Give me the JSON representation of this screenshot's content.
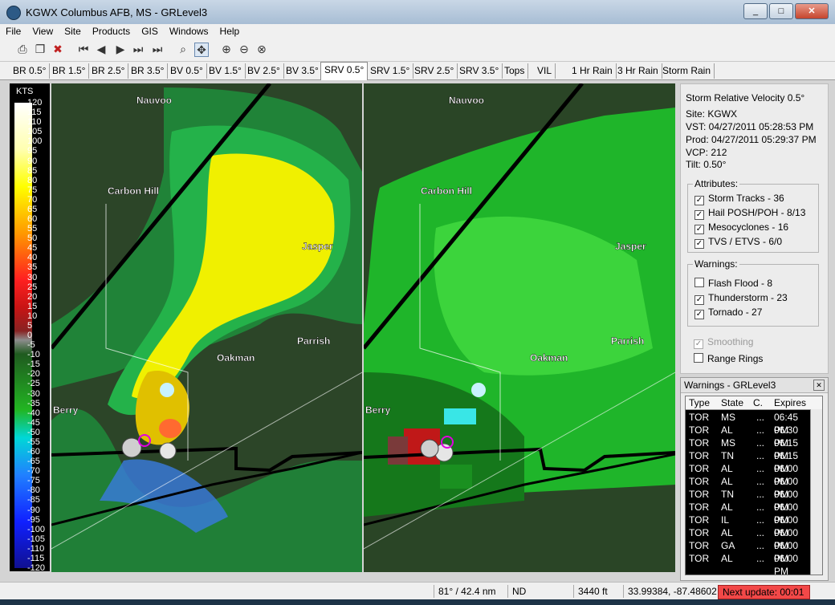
{
  "window": {
    "title": "KGWX Columbus AFB, MS - GRLevel3"
  },
  "menu": [
    "File",
    "View",
    "Site",
    "Products",
    "GIS",
    "Windows",
    "Help"
  ],
  "tabs": [
    "BR 0.5°",
    "BR 1.5°",
    "BR 2.5°",
    "BR 3.5°",
    "BV 0.5°",
    "BV 1.5°",
    "BV 2.5°",
    "BV 3.5°",
    "SRV 0.5°",
    "SRV 1.5°",
    "SRV 2.5°",
    "SRV 3.5°",
    "Tops",
    "VIL",
    "1 Hr Rain",
    "3 Hr Rain",
    "Storm Rain"
  ],
  "active_tab": "SRV 0.5°",
  "scale": {
    "unit": "KTS",
    "ticks": [
      "120",
      "115",
      "110",
      "105",
      "100",
      "95",
      "90",
      "85",
      "80",
      "75",
      "70",
      "65",
      "60",
      "55",
      "50",
      "45",
      "40",
      "35",
      "30",
      "25",
      "20",
      "15",
      "10",
      "5",
      "0",
      "-5",
      "-10",
      "-15",
      "-20",
      "-25",
      "-30",
      "-35",
      "-40",
      "-45",
      "-50",
      "-55",
      "-60",
      "-65",
      "-70",
      "-75",
      "-80",
      "-85",
      "-90",
      "-95",
      "-100",
      "-105",
      "-110",
      "-115",
      "-120"
    ]
  },
  "cities": [
    "Nauvoo",
    "Carbon Hill",
    "Jasper",
    "Parrish",
    "Oakman",
    "Berry"
  ],
  "info": {
    "product": "Storm Relative Velocity 0.5°",
    "site": "Site:  KGWX",
    "vst": "VST:  04/27/2011  05:28:53 PM",
    "prod": "Prod: 04/27/2011  05:29:37 PM",
    "vcp": "VCP:  212",
    "tilt": "Tilt:  0.50°"
  },
  "attributes": {
    "label": "Attributes:",
    "items": [
      {
        "label": "Storm Tracks - 36",
        "checked": true
      },
      {
        "label": "Hail POSH/POH - 8/13",
        "checked": true
      },
      {
        "label": "Mesocyclones - 16",
        "checked": true
      },
      {
        "label": "TVS / ETVS - 6/0",
        "checked": true
      }
    ]
  },
  "warnings_group": {
    "label": "Warnings:",
    "items": [
      {
        "label": "Flash Flood - 8",
        "checked": false
      },
      {
        "label": "Thunderstorm - 23",
        "checked": true
      },
      {
        "label": "Tornado - 27",
        "checked": true
      }
    ]
  },
  "options": {
    "smoothing": {
      "label": "Smoothing",
      "checked": true
    },
    "range_rings": {
      "label": "Range Rings",
      "checked": false
    }
  },
  "warnings_panel": {
    "title": "Warnings - GRLevel3",
    "columns": [
      "Type",
      "State",
      "C.",
      "Expires"
    ],
    "rows": [
      [
        "TOR",
        "MS",
        "...",
        "06:45 PM"
      ],
      [
        "TOR",
        "AL",
        "...",
        "06:30 PM"
      ],
      [
        "TOR",
        "MS",
        "...",
        "06:15 PM"
      ],
      [
        "TOR",
        "TN",
        "...",
        "06:15 PM"
      ],
      [
        "TOR",
        "AL",
        "...",
        "06:00 PM"
      ],
      [
        "TOR",
        "AL",
        "...",
        "06:00 PM"
      ],
      [
        "TOR",
        "TN",
        "...",
        "06:00 PM"
      ],
      [
        "TOR",
        "AL",
        "...",
        "06:00 PM"
      ],
      [
        "TOR",
        "IL",
        "...",
        "06:00 PM"
      ],
      [
        "TOR",
        "AL",
        "...",
        "06:00 PM"
      ],
      [
        "TOR",
        "GA",
        "...",
        "06:00 PM"
      ],
      [
        "TOR",
        "AL",
        "...",
        "06:00 PM"
      ]
    ]
  },
  "status": {
    "azimuth": "81° / 42.4 nm",
    "value": "ND",
    "height": "3440 ft",
    "coords": "33.99384, -87.48602",
    "next_update": "Next update: 00:01"
  },
  "colors": {
    "positive_max": "#ffffff",
    "yellow": "#ffff00",
    "red": "#ff0000",
    "gray_zero": "#8c8c8c",
    "green": "#22b522",
    "cyan": "#00ffff",
    "blue": "#1020ff",
    "next_update_bg": "#f24848"
  }
}
